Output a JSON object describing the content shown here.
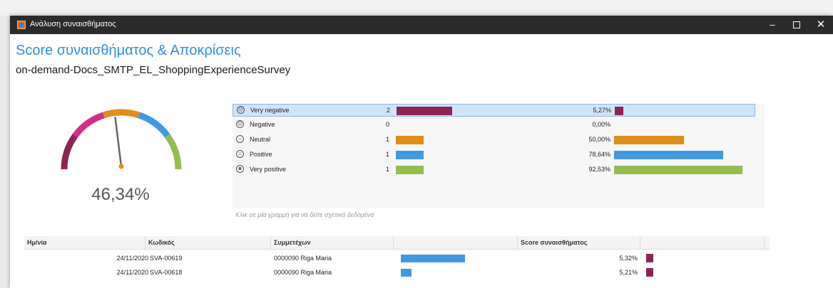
{
  "window": {
    "title": "Ανάλυση συναισθήματος",
    "minimize": "–",
    "close": "✕"
  },
  "page": {
    "title": "Score συναισθήματος & Αποκρίσεις",
    "subtitle": "on-demand-Docs_SMTP_EL_ShoppingExperienceSurvey"
  },
  "gauge": {
    "value_label": "46,34%",
    "value": 46.34,
    "segments": [
      "#8b2455",
      "#d42d8c",
      "#e28e14",
      "#3e9ae3",
      "#94bd4f"
    ]
  },
  "distribution": {
    "selected_index": 0,
    "rows": [
      {
        "label": "Very negative",
        "count": 2,
        "count_label": "2",
        "percent": 5.27,
        "percent_label": "5,27%",
        "color": "#8b2455",
        "icon": "very-negative-face-icon",
        "glyph": "☹"
      },
      {
        "label": "Negative",
        "count": 0,
        "count_label": "0",
        "percent": 0.0,
        "percent_label": "0,00%",
        "color": "#d42d8c",
        "icon": "negative-face-icon",
        "glyph": "☹"
      },
      {
        "label": "Neutral",
        "count": 1,
        "count_label": "1",
        "percent": 50.0,
        "percent_label": "50,00%",
        "color": "#e28e14",
        "icon": "neutral-face-icon",
        "glyph": "–"
      },
      {
        "label": "Positive",
        "count": 1,
        "count_label": "1",
        "percent": 78.64,
        "percent_label": "78,64%",
        "color": "#3e9ae3",
        "icon": "positive-face-icon",
        "glyph": "☺"
      },
      {
        "label": "Very positive",
        "count": 1,
        "count_label": "1",
        "percent": 92.53,
        "percent_label": "92,53%",
        "color": "#94bd4f",
        "icon": "very-positive-face-icon",
        "glyph": "☻"
      }
    ],
    "hint": "Κλικ σε μία γραμμή για να δείτε σχετικά δεδομένα"
  },
  "table": {
    "headers": [
      "Ημ/νία",
      "Κωδικός",
      "Συμμετέχων",
      "",
      "Score συναισθήματος",
      ""
    ],
    "rows": [
      {
        "date": "24/11/2020",
        "code": "SVA-00619",
        "participant": "0000090 Riga Maria",
        "bar": 1.0,
        "score": "5,32%"
      },
      {
        "date": "24/11/2020",
        "code": "SVA-00618",
        "participant": "0000090 Riga Maria",
        "bar": 0.17,
        "score": "5,21%"
      }
    ]
  }
}
